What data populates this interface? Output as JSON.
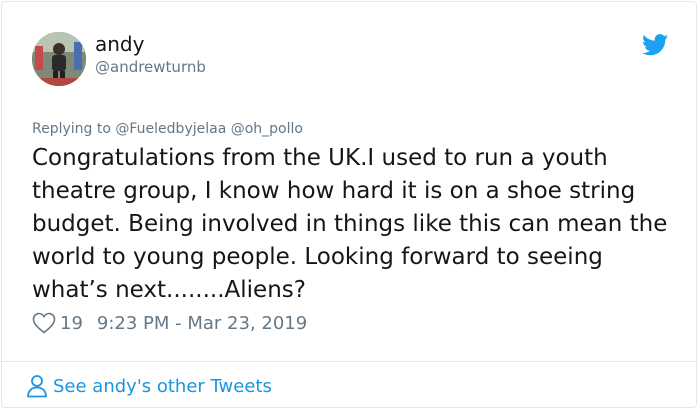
{
  "tweet": {
    "author_name": "andy",
    "author_handle": "@andrewturnb",
    "replying_label": "Replying to",
    "replying_mentions": [
      "@Fueledbyjelaa",
      "@oh_pollo"
    ],
    "text": "Congratulations from the UK.I used to run a youth theatre group, I know how hard it is on a shoe string budget. Being involved in things like this can mean the world to young people. Looking forward to seeing what’s next........Aliens?",
    "likes": "19",
    "timestamp": "9:23 PM - Mar 23, 2019",
    "see_more": "See andy's other Tweets"
  },
  "icons": {
    "brand": "twitter-bird-icon",
    "like": "heart-icon",
    "profile": "person-icon"
  },
  "colors": {
    "accent": "#1da1f2",
    "link": "#1b95e0",
    "muted": "#657786",
    "text": "#14171a",
    "border": "#e1e8ed"
  }
}
